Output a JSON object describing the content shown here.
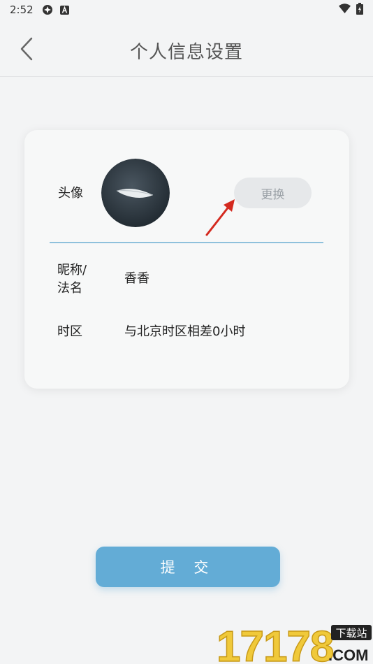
{
  "status_bar": {
    "time": "2:52",
    "icons_left": [
      "settings-gear-icon",
      "a-box-icon"
    ],
    "icons_right": [
      "wifi-icon",
      "battery-icon"
    ]
  },
  "header": {
    "back_icon": "chevron-left-icon",
    "title": "个人信息设置"
  },
  "profile": {
    "avatar_label": "头像",
    "change_button": "更换",
    "nickname_label": "昵称/",
    "nickname_label_line2": "法名",
    "nickname_value": "香香",
    "timezone_label": "时区",
    "timezone_value": "与北京时区相差0小时"
  },
  "submit_button": "提 交",
  "watermark": {
    "digits": "17178",
    "tag": "下载站",
    "domain": ".COM"
  },
  "colors": {
    "accent": "#63acd6",
    "divider": "#8fc1dc",
    "arrow": "#d42a1f",
    "background": "#f3f4f5"
  }
}
